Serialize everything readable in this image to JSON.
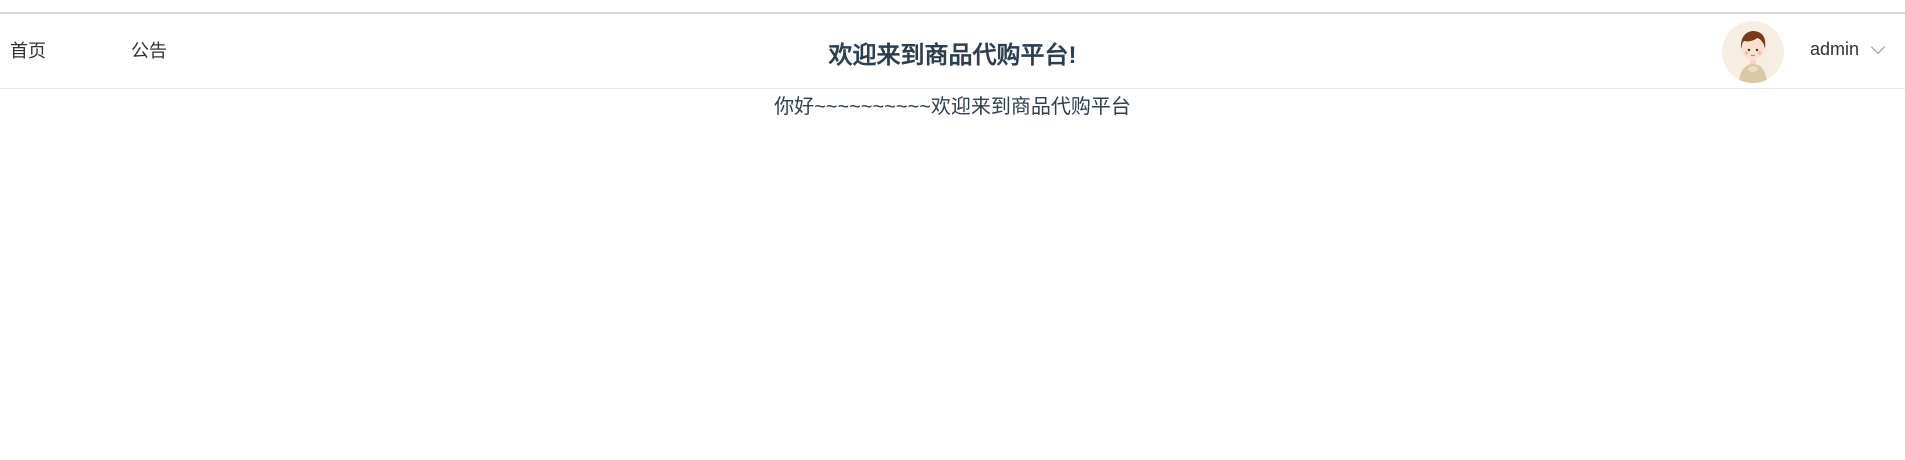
{
  "nav": {
    "items": [
      {
        "label": "首页"
      },
      {
        "label": "公告"
      }
    ]
  },
  "header": {
    "title": "欢迎来到商品代购平台!"
  },
  "user": {
    "name": "admin",
    "avatar_icon": "avatar-icon"
  },
  "main": {
    "welcome_text": "你好~~~~~~~~~~欢迎来到商品代购平台"
  },
  "colors": {
    "title": "#2c3e50",
    "divider": "#e6e6e6",
    "avatar_bg": "#f7eee3"
  }
}
